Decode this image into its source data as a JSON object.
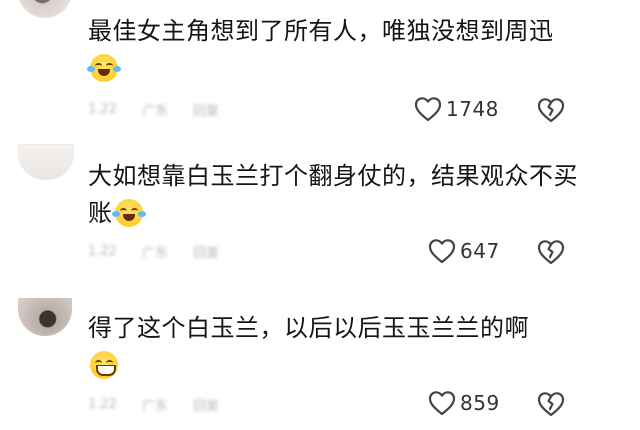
{
  "comments": [
    {
      "text": "最佳女主角想到了所有人，唯独没想到周迅",
      "emoji": "laugh-cry-emoji",
      "meta_date": "1.22",
      "meta_location": "广东",
      "meta_reply": "回复",
      "likes": "1748"
    },
    {
      "text": "大如想靠白玉兰打个翻身仗的，结果观众不买账",
      "emoji": "laugh-cry-emoji",
      "meta_date": "1.22",
      "meta_location": "广东",
      "meta_reply": "回复",
      "likes": "647"
    },
    {
      "text": "得了这个白玉兰，以后以后玉玉兰兰的啊",
      "emoji": "grin-emoji",
      "meta_date": "1.22",
      "meta_location": "广东",
      "meta_reply": "回复",
      "likes": "859"
    }
  ],
  "icons": {
    "like": "heart-outline-icon",
    "dislike": "broken-heart-icon"
  },
  "colors": {
    "text": "#141414",
    "icon": "#444444",
    "meta": "#b8b8b8"
  }
}
